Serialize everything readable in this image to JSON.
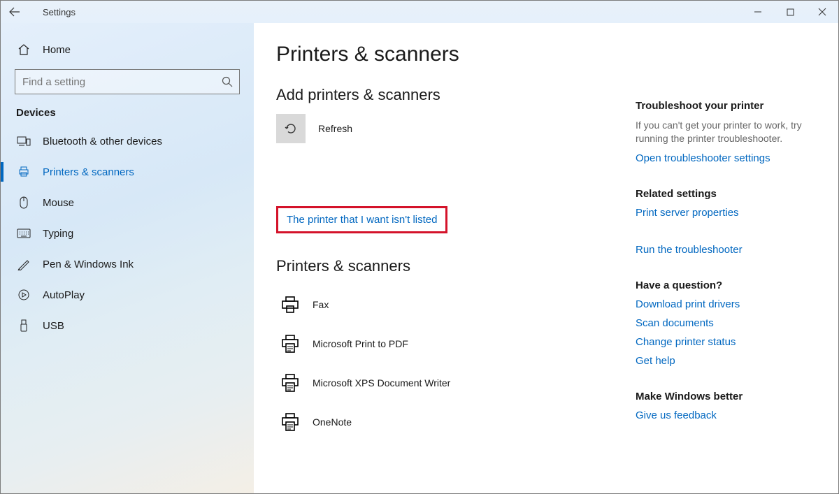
{
  "window": {
    "title": "Settings"
  },
  "sidebar": {
    "home_label": "Home",
    "search_placeholder": "Find a setting",
    "category_label": "Devices",
    "items": [
      {
        "label": "Bluetooth & other devices"
      },
      {
        "label": "Printers & scanners"
      },
      {
        "label": "Mouse"
      },
      {
        "label": "Typing"
      },
      {
        "label": "Pen & Windows Ink"
      },
      {
        "label": "AutoPlay"
      },
      {
        "label": "USB"
      }
    ]
  },
  "main": {
    "page_title": "Printers & scanners",
    "add_section": "Add printers & scanners",
    "refresh_label": "Refresh",
    "not_listed_link": "The printer that I want isn't listed",
    "printers_section": "Printers & scanners",
    "printers": [
      {
        "label": "Fax"
      },
      {
        "label": "Microsoft Print to PDF"
      },
      {
        "label": "Microsoft XPS Document Writer"
      },
      {
        "label": "OneNote"
      }
    ]
  },
  "right": {
    "troubleshoot_title": "Troubleshoot your printer",
    "troubleshoot_text": "If you can't get your printer to work, try running the printer troubleshooter.",
    "troubleshoot_link": "Open troubleshooter settings",
    "related_title": "Related settings",
    "related_links": [
      {
        "label": "Print server properties"
      },
      {
        "label": "Run the troubleshooter"
      }
    ],
    "question_title": "Have a question?",
    "question_links": [
      {
        "label": "Download print drivers"
      },
      {
        "label": "Scan documents"
      },
      {
        "label": "Change printer status"
      },
      {
        "label": "Get help"
      }
    ],
    "better_title": "Make Windows better",
    "better_link": "Give us feedback"
  }
}
